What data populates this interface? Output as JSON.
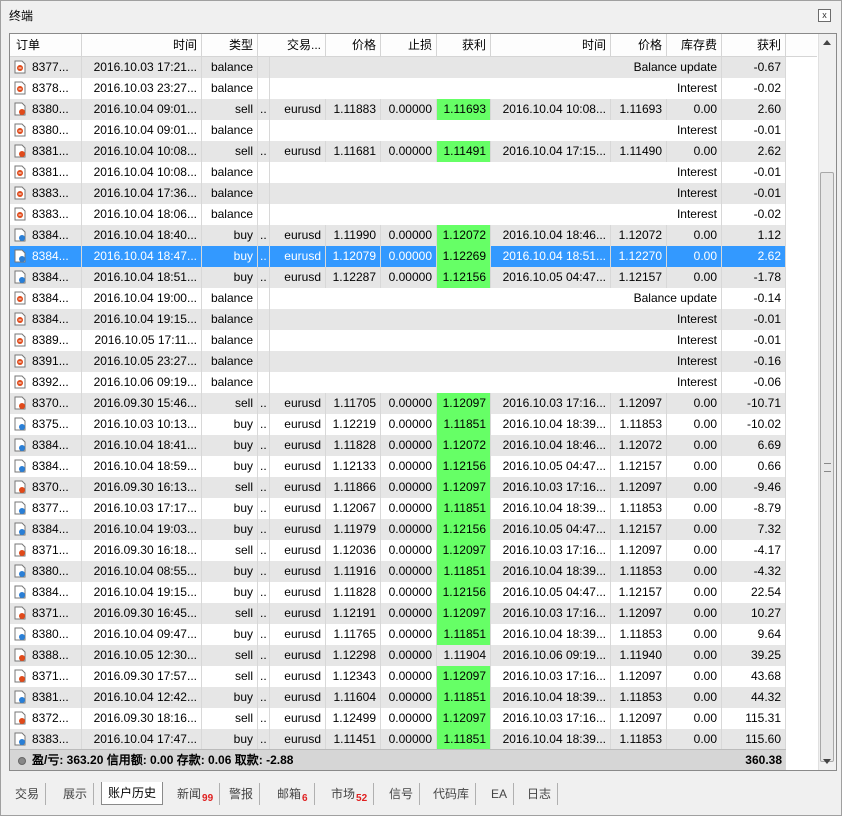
{
  "window": {
    "title": "终端",
    "close_label": "x"
  },
  "columns": [
    "订单",
    "时间",
    "类型",
    "交易...",
    "价格",
    "止损",
    "获利",
    "时间",
    "价格",
    "库存费",
    "获利"
  ],
  "rows": [
    {
      "order": "8377...",
      "time": "2016.10.03 17:21...",
      "type": "balance",
      "sym": "",
      "price": "",
      "sl": "",
      "tp": "",
      "tp_green": false,
      "ctime": "",
      "cprice": "",
      "swap": "",
      "comment": "Balance update",
      "profit": "-0.67",
      "dir": "bal"
    },
    {
      "order": "8378...",
      "time": "2016.10.03 23:27...",
      "type": "balance",
      "sym": "",
      "price": "",
      "sl": "",
      "tp": "",
      "tp_green": false,
      "ctime": "",
      "cprice": "",
      "swap": "",
      "comment": "Interest",
      "profit": "-0.02",
      "dir": "bal"
    },
    {
      "order": "8380...",
      "time": "2016.10.04 09:01...",
      "type": "sell",
      "sym": "eurusd",
      "price": "1.11883",
      "sl": "0.00000",
      "tp": "1.11693",
      "tp_green": true,
      "ctime": "2016.10.04 10:08...",
      "cprice": "1.11693",
      "swap": "0.00",
      "comment": "",
      "profit": "2.60",
      "dir": "sell"
    },
    {
      "order": "8380...",
      "time": "2016.10.04 09:01...",
      "type": "balance",
      "sym": "",
      "price": "",
      "sl": "",
      "tp": "",
      "tp_green": false,
      "ctime": "",
      "cprice": "",
      "swap": "",
      "comment": "Interest",
      "profit": "-0.01",
      "dir": "bal"
    },
    {
      "order": "8381...",
      "time": "2016.10.04 10:08...",
      "type": "sell",
      "sym": "eurusd",
      "price": "1.11681",
      "sl": "0.00000",
      "tp": "1.11491",
      "tp_green": true,
      "ctime": "2016.10.04 17:15...",
      "cprice": "1.11490",
      "swap": "0.00",
      "comment": "",
      "profit": "2.62",
      "dir": "sell"
    },
    {
      "order": "8381...",
      "time": "2016.10.04 10:08...",
      "type": "balance",
      "sym": "",
      "price": "",
      "sl": "",
      "tp": "",
      "tp_green": false,
      "ctime": "",
      "cprice": "",
      "swap": "",
      "comment": "Interest",
      "profit": "-0.01",
      "dir": "bal"
    },
    {
      "order": "8383...",
      "time": "2016.10.04 17:36...",
      "type": "balance",
      "sym": "",
      "price": "",
      "sl": "",
      "tp": "",
      "tp_green": false,
      "ctime": "",
      "cprice": "",
      "swap": "",
      "comment": "Interest",
      "profit": "-0.01",
      "dir": "bal"
    },
    {
      "order": "8383...",
      "time": "2016.10.04 18:06...",
      "type": "balance",
      "sym": "",
      "price": "",
      "sl": "",
      "tp": "",
      "tp_green": false,
      "ctime": "",
      "cprice": "",
      "swap": "",
      "comment": "Interest",
      "profit": "-0.02",
      "dir": "bal"
    },
    {
      "order": "8384...",
      "time": "2016.10.04 18:40...",
      "type": "buy",
      "sym": "eurusd",
      "price": "1.11990",
      "sl": "0.00000",
      "tp": "1.12072",
      "tp_green": true,
      "ctime": "2016.10.04 18:46...",
      "cprice": "1.12072",
      "swap": "0.00",
      "comment": "",
      "profit": "1.12",
      "dir": "buy"
    },
    {
      "order": "8384...",
      "time": "2016.10.04 18:47...",
      "type": "buy",
      "sym": "eurusd",
      "price": "1.12079",
      "sl": "0.00000",
      "tp": "1.12269",
      "tp_green": true,
      "ctime": "2016.10.04 18:51...",
      "cprice": "1.12270",
      "swap": "0.00",
      "comment": "",
      "profit": "2.62",
      "dir": "buy",
      "selected": true
    },
    {
      "order": "8384...",
      "time": "2016.10.04 18:51...",
      "type": "buy",
      "sym": "eurusd",
      "price": "1.12287",
      "sl": "0.00000",
      "tp": "1.12156",
      "tp_green": true,
      "ctime": "2016.10.05 04:47...",
      "cprice": "1.12157",
      "swap": "0.00",
      "comment": "",
      "profit": "-1.78",
      "dir": "buy"
    },
    {
      "order": "8384...",
      "time": "2016.10.04 19:00...",
      "type": "balance",
      "sym": "",
      "price": "",
      "sl": "",
      "tp": "",
      "tp_green": false,
      "ctime": "",
      "cprice": "",
      "swap": "",
      "comment": "Balance update",
      "profit": "-0.14",
      "dir": "bal"
    },
    {
      "order": "8384...",
      "time": "2016.10.04 19:15...",
      "type": "balance",
      "sym": "",
      "price": "",
      "sl": "",
      "tp": "",
      "tp_green": false,
      "ctime": "",
      "cprice": "",
      "swap": "",
      "comment": "Interest",
      "profit": "-0.01",
      "dir": "bal"
    },
    {
      "order": "8389...",
      "time": "2016.10.05 17:11...",
      "type": "balance",
      "sym": "",
      "price": "",
      "sl": "",
      "tp": "",
      "tp_green": false,
      "ctime": "",
      "cprice": "",
      "swap": "",
      "comment": "Interest",
      "profit": "-0.01",
      "dir": "bal"
    },
    {
      "order": "8391...",
      "time": "2016.10.05 23:27...",
      "type": "balance",
      "sym": "",
      "price": "",
      "sl": "",
      "tp": "",
      "tp_green": false,
      "ctime": "",
      "cprice": "",
      "swap": "",
      "comment": "Interest",
      "profit": "-0.16",
      "dir": "bal"
    },
    {
      "order": "8392...",
      "time": "2016.10.06 09:19...",
      "type": "balance",
      "sym": "",
      "price": "",
      "sl": "",
      "tp": "",
      "tp_green": false,
      "ctime": "",
      "cprice": "",
      "swap": "",
      "comment": "Interest",
      "profit": "-0.06",
      "dir": "bal"
    },
    {
      "order": "8370...",
      "time": "2016.09.30 15:46...",
      "type": "sell",
      "sym": "eurusd",
      "price": "1.11705",
      "sl": "0.00000",
      "tp": "1.12097",
      "tp_green": true,
      "ctime": "2016.10.03 17:16...",
      "cprice": "1.12097",
      "swap": "0.00",
      "comment": "",
      "profit": "-10.71",
      "dir": "sell"
    },
    {
      "order": "8375...",
      "time": "2016.10.03 10:13...",
      "type": "buy",
      "sym": "eurusd",
      "price": "1.12219",
      "sl": "0.00000",
      "tp": "1.11851",
      "tp_green": true,
      "ctime": "2016.10.04 18:39...",
      "cprice": "1.11853",
      "swap": "0.00",
      "comment": "",
      "profit": "-10.02",
      "dir": "buy"
    },
    {
      "order": "8384...",
      "time": "2016.10.04 18:41...",
      "type": "buy",
      "sym": "eurusd",
      "price": "1.11828",
      "sl": "0.00000",
      "tp": "1.12072",
      "tp_green": true,
      "ctime": "2016.10.04 18:46...",
      "cprice": "1.12072",
      "swap": "0.00",
      "comment": "",
      "profit": "6.69",
      "dir": "buy"
    },
    {
      "order": "8384...",
      "time": "2016.10.04 18:59...",
      "type": "buy",
      "sym": "eurusd",
      "price": "1.12133",
      "sl": "0.00000",
      "tp": "1.12156",
      "tp_green": true,
      "ctime": "2016.10.05 04:47...",
      "cprice": "1.12157",
      "swap": "0.00",
      "comment": "",
      "profit": "0.66",
      "dir": "buy"
    },
    {
      "order": "8370...",
      "time": "2016.09.30 16:13...",
      "type": "sell",
      "sym": "eurusd",
      "price": "1.11866",
      "sl": "0.00000",
      "tp": "1.12097",
      "tp_green": true,
      "ctime": "2016.10.03 17:16...",
      "cprice": "1.12097",
      "swap": "0.00",
      "comment": "",
      "profit": "-9.46",
      "dir": "sell"
    },
    {
      "order": "8377...",
      "time": "2016.10.03 17:17...",
      "type": "buy",
      "sym": "eurusd",
      "price": "1.12067",
      "sl": "0.00000",
      "tp": "1.11851",
      "tp_green": true,
      "ctime": "2016.10.04 18:39...",
      "cprice": "1.11853",
      "swap": "0.00",
      "comment": "",
      "profit": "-8.79",
      "dir": "buy"
    },
    {
      "order": "8384...",
      "time": "2016.10.04 19:03...",
      "type": "buy",
      "sym": "eurusd",
      "price": "1.11979",
      "sl": "0.00000",
      "tp": "1.12156",
      "tp_green": true,
      "ctime": "2016.10.05 04:47...",
      "cprice": "1.12157",
      "swap": "0.00",
      "comment": "",
      "profit": "7.32",
      "dir": "buy"
    },
    {
      "order": "8371...",
      "time": "2016.09.30 16:18...",
      "type": "sell",
      "sym": "eurusd",
      "price": "1.12036",
      "sl": "0.00000",
      "tp": "1.12097",
      "tp_green": true,
      "ctime": "2016.10.03 17:16...",
      "cprice": "1.12097",
      "swap": "0.00",
      "comment": "",
      "profit": "-4.17",
      "dir": "sell"
    },
    {
      "order": "8380...",
      "time": "2016.10.04 08:55...",
      "type": "buy",
      "sym": "eurusd",
      "price": "1.11916",
      "sl": "0.00000",
      "tp": "1.11851",
      "tp_green": true,
      "ctime": "2016.10.04 18:39...",
      "cprice": "1.11853",
      "swap": "0.00",
      "comment": "",
      "profit": "-4.32",
      "dir": "buy"
    },
    {
      "order": "8384...",
      "time": "2016.10.04 19:15...",
      "type": "buy",
      "sym": "eurusd",
      "price": "1.11828",
      "sl": "0.00000",
      "tp": "1.12156",
      "tp_green": true,
      "ctime": "2016.10.05 04:47...",
      "cprice": "1.12157",
      "swap": "0.00",
      "comment": "",
      "profit": "22.54",
      "dir": "buy"
    },
    {
      "order": "8371...",
      "time": "2016.09.30 16:45...",
      "type": "sell",
      "sym": "eurusd",
      "price": "1.12191",
      "sl": "0.00000",
      "tp": "1.12097",
      "tp_green": true,
      "ctime": "2016.10.03 17:16...",
      "cprice": "1.12097",
      "swap": "0.00",
      "comment": "",
      "profit": "10.27",
      "dir": "sell"
    },
    {
      "order": "8380...",
      "time": "2016.10.04 09:47...",
      "type": "buy",
      "sym": "eurusd",
      "price": "1.11765",
      "sl": "0.00000",
      "tp": "1.11851",
      "tp_green": true,
      "ctime": "2016.10.04 18:39...",
      "cprice": "1.11853",
      "swap": "0.00",
      "comment": "",
      "profit": "9.64",
      "dir": "buy"
    },
    {
      "order": "8388...",
      "time": "2016.10.05 12:30...",
      "type": "sell",
      "sym": "eurusd",
      "price": "1.12298",
      "sl": "0.00000",
      "tp": "1.11904",
      "tp_green": false,
      "ctime": "2016.10.06 09:19...",
      "cprice": "1.11940",
      "swap": "0.00",
      "comment": "",
      "profit": "39.25",
      "dir": "sell"
    },
    {
      "order": "8371...",
      "time": "2016.09.30 17:57...",
      "type": "sell",
      "sym": "eurusd",
      "price": "1.12343",
      "sl": "0.00000",
      "tp": "1.12097",
      "tp_green": true,
      "ctime": "2016.10.03 17:16...",
      "cprice": "1.12097",
      "swap": "0.00",
      "comment": "",
      "profit": "43.68",
      "dir": "sell"
    },
    {
      "order": "8381...",
      "time": "2016.10.04 12:42...",
      "type": "buy",
      "sym": "eurusd",
      "price": "1.11604",
      "sl": "0.00000",
      "tp": "1.11851",
      "tp_green": true,
      "ctime": "2016.10.04 18:39...",
      "cprice": "1.11853",
      "swap": "0.00",
      "comment": "",
      "profit": "44.32",
      "dir": "buy"
    },
    {
      "order": "8372...",
      "time": "2016.09.30 18:16...",
      "type": "sell",
      "sym": "eurusd",
      "price": "1.12499",
      "sl": "0.00000",
      "tp": "1.12097",
      "tp_green": true,
      "ctime": "2016.10.03 17:16...",
      "cprice": "1.12097",
      "swap": "0.00",
      "comment": "",
      "profit": "115.31",
      "dir": "sell"
    },
    {
      "order": "8383...",
      "time": "2016.10.04 17:47...",
      "type": "buy",
      "sym": "eurusd",
      "price": "1.11451",
      "sl": "0.00000",
      "tp": "1.11851",
      "tp_green": true,
      "ctime": "2016.10.04 18:39...",
      "cprice": "1.11853",
      "swap": "0.00",
      "comment": "",
      "profit": "115.60",
      "dir": "buy"
    }
  ],
  "footer": {
    "summary": "盈/亏: 363.20  信用额: 0.00  存款: 0.06  取款: -2.88",
    "total": "360.38"
  },
  "tabs": [
    {
      "label": "交易",
      "badge": ""
    },
    {
      "label": "展示",
      "badge": ""
    },
    {
      "label": "账户历史",
      "badge": "",
      "active": true
    },
    {
      "label": "新闻",
      "badge": "99"
    },
    {
      "label": "警报",
      "badge": ""
    },
    {
      "label": "邮箱",
      "badge": "6"
    },
    {
      "label": "市场",
      "badge": "52"
    },
    {
      "label": "信号",
      "badge": ""
    },
    {
      "label": "代码库",
      "badge": ""
    },
    {
      "label": "EA",
      "badge": ""
    },
    {
      "label": "日志",
      "badge": ""
    }
  ],
  "colors": {
    "selected_row": "#3399ff",
    "takeprofit_hit": "#66ff66",
    "odd_row": "#e6e6e6",
    "sell_icon": "#e04a1a",
    "buy_icon": "#2a7fd6"
  }
}
